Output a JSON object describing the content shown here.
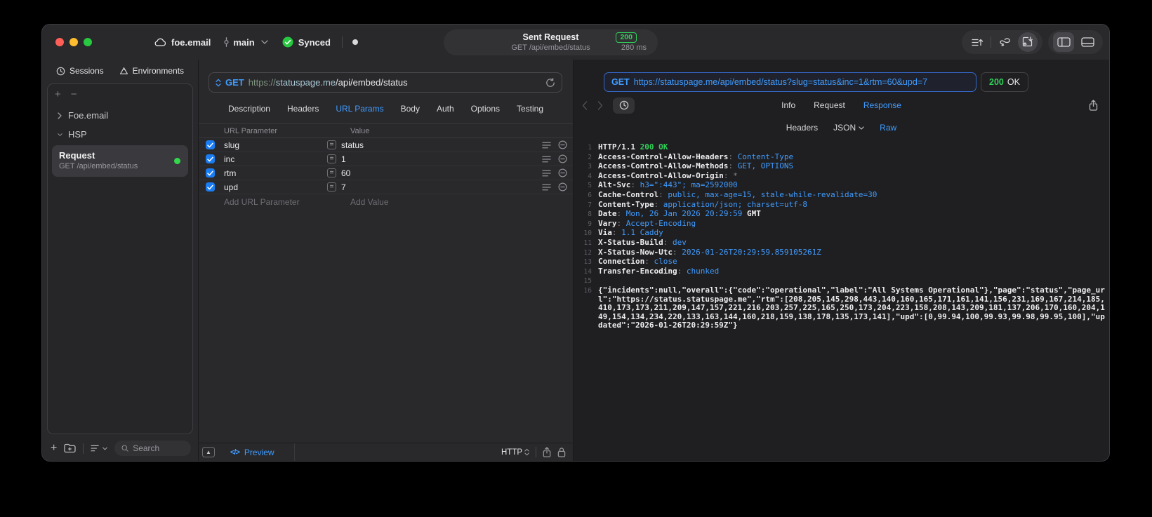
{
  "titlebar": {
    "project": "foe.email",
    "branch": "main",
    "sync_label": "Synced",
    "summary": {
      "title": "Sent Request",
      "status_code": "200",
      "request_line": "GET /api/embed/status",
      "duration": "280 ms"
    }
  },
  "sidebar": {
    "tabs": [
      {
        "label": "Sessions"
      },
      {
        "label": "Environments"
      }
    ],
    "tree": [
      {
        "label": "Foe.email"
      },
      {
        "label": "HSP"
      }
    ],
    "request": {
      "title": "Request",
      "subtitle": "GET /api/embed/status"
    },
    "search_placeholder": "Search"
  },
  "request_pane": {
    "method": "GET",
    "url": {
      "scheme": "https://",
      "host": "statuspage.me",
      "path": "/api/embed/status"
    },
    "tabs": [
      "Description",
      "Headers",
      "URL Params",
      "Body",
      "Auth",
      "Options",
      "Testing"
    ],
    "active_tab": "URL Params",
    "params": {
      "columns": {
        "name": "URL Parameter",
        "value": "Value"
      },
      "rows": [
        {
          "name": "slug",
          "value": "status",
          "enabled": true
        },
        {
          "name": "inc",
          "value": "1",
          "enabled": true
        },
        {
          "name": "rtm",
          "value": "60",
          "enabled": true
        },
        {
          "name": "upd",
          "value": "7",
          "enabled": true
        }
      ],
      "add_name_placeholder": "Add URL Parameter",
      "add_value_placeholder": "Add Value"
    },
    "footer": {
      "preview_label": "Preview",
      "code_glyph": "</>",
      "protocol": "HTTP"
    }
  },
  "response_pane": {
    "request_url": {
      "method": "GET",
      "url": "https://statuspage.me/api/embed/status?slug=status&inc=1&rtm=60&upd=7"
    },
    "status": {
      "code": "200",
      "text": "OK"
    },
    "tabs": [
      "Info",
      "Request",
      "Response"
    ],
    "active_tab": "Response",
    "subtabs": [
      {
        "label": "Headers"
      },
      {
        "label": "JSON",
        "has_menu": true
      },
      {
        "label": "Raw"
      }
    ],
    "active_subtab": "Raw",
    "body_lines": [
      {
        "n": "1",
        "parts": [
          {
            "t": "HTTP/1.1 ",
            "c": "w"
          },
          {
            "t": "200 OK",
            "c": "g"
          }
        ]
      },
      {
        "n": "2",
        "parts": [
          {
            "t": "Access-Control-Allow-Headers",
            "c": "w"
          },
          {
            "t": ": ",
            "c": "d"
          },
          {
            "t": "Content-Type",
            "c": "b"
          }
        ]
      },
      {
        "n": "3",
        "parts": [
          {
            "t": "Access-Control-Allow-Methods",
            "c": "w"
          },
          {
            "t": ": ",
            "c": "d"
          },
          {
            "t": "GET, OPTIONS",
            "c": "b"
          }
        ]
      },
      {
        "n": "4",
        "parts": [
          {
            "t": "Access-Control-Allow-Origin",
            "c": "w"
          },
          {
            "t": ": ",
            "c": "d"
          },
          {
            "t": "*",
            "c": "d"
          }
        ]
      },
      {
        "n": "5",
        "parts": [
          {
            "t": "Alt-Svc",
            "c": "w"
          },
          {
            "t": ": ",
            "c": "d"
          },
          {
            "t": "h3=\":443\"; ma=2592000",
            "c": "b"
          }
        ]
      },
      {
        "n": "6",
        "parts": [
          {
            "t": "Cache-Control",
            "c": "w"
          },
          {
            "t": ": ",
            "c": "d"
          },
          {
            "t": "public, max-age=15, stale-while-revalidate=30",
            "c": "b"
          }
        ]
      },
      {
        "n": "7",
        "parts": [
          {
            "t": "Content-Type",
            "c": "w"
          },
          {
            "t": ": ",
            "c": "d"
          },
          {
            "t": "application/json; charset=utf-8",
            "c": "b"
          }
        ]
      },
      {
        "n": "8",
        "parts": [
          {
            "t": "Date",
            "c": "w"
          },
          {
            "t": ": ",
            "c": "d"
          },
          {
            "t": "Mon, 26 Jan 2026 20:29:59",
            "c": "b"
          },
          {
            "t": " GMT",
            "c": "w"
          }
        ]
      },
      {
        "n": "9",
        "parts": [
          {
            "t": "Vary",
            "c": "w"
          },
          {
            "t": ": ",
            "c": "d"
          },
          {
            "t": "Accept-Encoding",
            "c": "b"
          }
        ]
      },
      {
        "n": "10",
        "parts": [
          {
            "t": "Via",
            "c": "w"
          },
          {
            "t": ": ",
            "c": "d"
          },
          {
            "t": "1.1 Caddy",
            "c": "b"
          }
        ]
      },
      {
        "n": "11",
        "parts": [
          {
            "t": "X-Status-Build",
            "c": "w"
          },
          {
            "t": ": ",
            "c": "d"
          },
          {
            "t": "dev",
            "c": "b"
          }
        ]
      },
      {
        "n": "12",
        "parts": [
          {
            "t": "X-Status-Now-Utc",
            "c": "w"
          },
          {
            "t": ": ",
            "c": "d"
          },
          {
            "t": "2026-01-26T20:29:59.859105261Z",
            "c": "b"
          }
        ]
      },
      {
        "n": "13",
        "parts": [
          {
            "t": "Connection",
            "c": "w"
          },
          {
            "t": ": ",
            "c": "d"
          },
          {
            "t": "close",
            "c": "b"
          }
        ]
      },
      {
        "n": "14",
        "parts": [
          {
            "t": "Transfer-Encoding",
            "c": "w"
          },
          {
            "t": ": ",
            "c": "d"
          },
          {
            "t": "chunked",
            "c": "b"
          }
        ]
      },
      {
        "n": "15",
        "parts": []
      },
      {
        "n": "16",
        "parts": [
          {
            "t": "{\"incidents\":null,\"overall\":{\"code\":\"operational\",\"label\":\"All Systems Operational\"},\"page\":\"status\",\"page_url\":\"https://status.statuspage.me\",\"rtm\":[208,205,145,298,443,140,160,165,171,161,141,156,231,169,167,214,185,410,173,173,211,209,147,157,221,216,203,257,225,165,250,173,204,223,158,208,143,209,181,137,206,170,160,204,149,154,134,234,220,133,163,144,160,218,159,138,178,135,173,141],\"upd\":[0,99.94,100,99.93,99.98,99.95,100],\"updated\":\"2026-01-26T20:29:59Z\"}",
            "c": "w"
          }
        ]
      }
    ]
  },
  "colors": {
    "accent_blue": "#409cff",
    "green": "#30d158",
    "traffic_red": "#ff5f57",
    "traffic_yellow": "#febc2e",
    "traffic_green": "#28c840",
    "checkbox_blue": "#1a7cf2"
  }
}
